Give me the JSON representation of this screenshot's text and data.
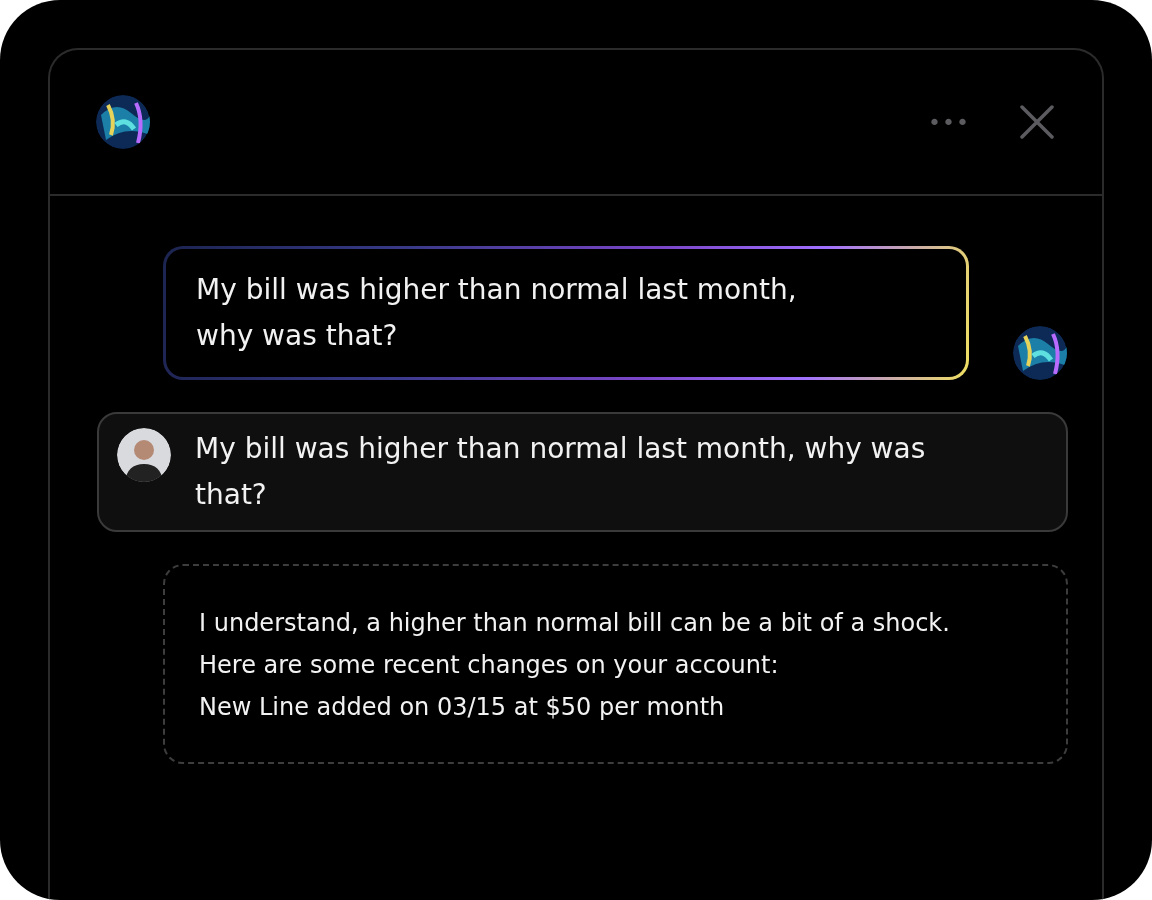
{
  "header": {
    "menu_icon": "•••"
  },
  "messages": [
    {
      "kind": "prompt",
      "lines": [
        "My bill was higher than normal last month,",
        "why was that?"
      ]
    },
    {
      "kind": "user",
      "lines": [
        "My bill was higher than normal last month, why was",
        "that?"
      ]
    },
    {
      "kind": "ai",
      "lines": [
        "I understand, a higher than normal bill can be a bit of a shock.",
        "Here are some recent changes on your account:",
        "New Line added on 03/15 at $50 per month"
      ]
    }
  ]
}
